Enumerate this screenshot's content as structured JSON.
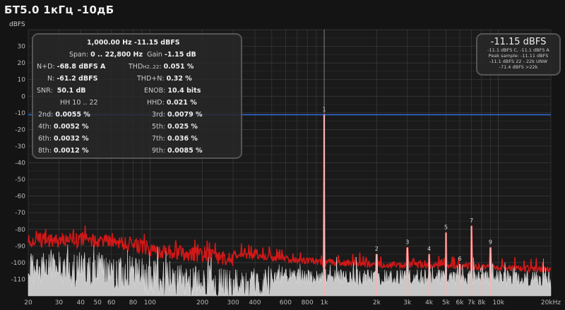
{
  "title": "БТ5.0 1кГц -10дБ",
  "y_unit": "dBFS",
  "stats": {
    "header": "1,000.00 Hz  -11.15 dBFS",
    "span_label": "Span:",
    "span_value": "0 .. 22,800 Hz",
    "gain_label": "Gain",
    "gain_value": "-1.15 dB",
    "nd_label": "N+D:",
    "nd_value": "-68.8 dBFS A",
    "thd_label": "THD",
    "thd_sub": "H2..22",
    "thd_value": "0.051 %",
    "n_label": "N:",
    "n_value": "-61.2 dBFS",
    "thdn_label": "THD+N:",
    "thdn_value": "0.32 %",
    "snr_label": "SNR:",
    "snr_value": "50.1 dB",
    "enob_label": "ENOB:",
    "enob_value": "10.4 bits",
    "hh_label": "HH 10 .. 22",
    "hhd_label": "HHD:",
    "hhd_value": "0.021 %",
    "harmonics": [
      {
        "label": "2nd:",
        "value": "0.0055 %"
      },
      {
        "label": "3rd:",
        "value": "0.0079 %"
      },
      {
        "label": "4th:",
        "value": "0.0052 %"
      },
      {
        "label": "5th:",
        "value": "0.025 %"
      },
      {
        "label": "6th:",
        "value": "0.0032 %"
      },
      {
        "label": "7th:",
        "value": "0.036 %"
      },
      {
        "label": "8th:",
        "value": "0.0012 %"
      },
      {
        "label": "9th:",
        "value": "0.0085 %"
      }
    ]
  },
  "level": {
    "main": "-11.15 dBFS",
    "lines": [
      "-11.1 dBFS C, -11.1 dBFS A",
      "Peak sample: -11.11 dBFS",
      "-11.1 dBFS 22 - 22k UNW",
      "-71.4 dBFS >22k"
    ]
  },
  "chart_data": {
    "type": "line",
    "xscale": "log",
    "xlim": [
      20,
      20000
    ],
    "ylim": [
      -120,
      40
    ],
    "ylabel": "dBFS",
    "grid": true,
    "x_ticks": [
      {
        "v": 20,
        "l": "20"
      },
      {
        "v": 30,
        "l": "30"
      },
      {
        "v": 40,
        "l": "40"
      },
      {
        "v": 50,
        "l": "50"
      },
      {
        "v": 60,
        "l": "60"
      },
      {
        "v": 80,
        "l": "80"
      },
      {
        "v": 100,
        "l": "100"
      },
      {
        "v": 200,
        "l": "200"
      },
      {
        "v": 300,
        "l": "300"
      },
      {
        "v": 400,
        "l": "400"
      },
      {
        "v": 600,
        "l": "600"
      },
      {
        "v": 800,
        "l": "800"
      },
      {
        "v": 1000,
        "l": "1k"
      },
      {
        "v": 2000,
        "l": "2k"
      },
      {
        "v": 3000,
        "l": "3k"
      },
      {
        "v": 4000,
        "l": "4k"
      },
      {
        "v": 5000,
        "l": "5k"
      },
      {
        "v": 6000,
        "l": "6k"
      },
      {
        "v": 7000,
        "l": "7k"
      },
      {
        "v": 8000,
        "l": "8k"
      },
      {
        "v": 10000,
        "l": "10k"
      },
      {
        "v": 20000,
        "l": "20kHz"
      }
    ],
    "y_ticks": [
      30,
      20,
      10,
      0,
      -10,
      -20,
      -30,
      -40,
      -50,
      -60,
      -70,
      -80,
      -90,
      -100,
      -110
    ],
    "reference_level": -11.15,
    "fundamental": {
      "freq": 1000,
      "level": -11.15,
      "label": "1"
    },
    "harmonics": [
      {
        "label": "2",
        "freq": 2000,
        "level": -95
      },
      {
        "label": "3",
        "freq": 3000,
        "level": -91
      },
      {
        "label": "4",
        "freq": 4000,
        "level": -95
      },
      {
        "label": "5",
        "freq": 5000,
        "level": -82
      },
      {
        "label": "6",
        "freq": 6000,
        "level": -101
      },
      {
        "label": "7",
        "freq": 7000,
        "level": -78
      },
      {
        "label": "8",
        "freq": 8000,
        "level": -108
      },
      {
        "label": "9",
        "freq": 9000,
        "level": -91
      }
    ],
    "noise_peak_floor": [
      [
        20,
        -82
      ],
      [
        60,
        -82
      ],
      [
        100,
        -88
      ],
      [
        300,
        -93
      ],
      [
        1000,
        -98
      ],
      [
        5000,
        -100
      ],
      [
        20000,
        -102
      ]
    ],
    "noise_avg_floor": [
      [
        20,
        -92
      ],
      [
        60,
        -94
      ],
      [
        100,
        -98
      ],
      [
        300,
        -102
      ],
      [
        1000,
        -104
      ],
      [
        5000,
        -104
      ],
      [
        20000,
        -105
      ]
    ],
    "colors": {
      "peak_trace": "#d01818",
      "spectrum_fill": "#c8c8c8",
      "reference_line": "#2f6de0",
      "grid": "#3a3a3a"
    }
  }
}
